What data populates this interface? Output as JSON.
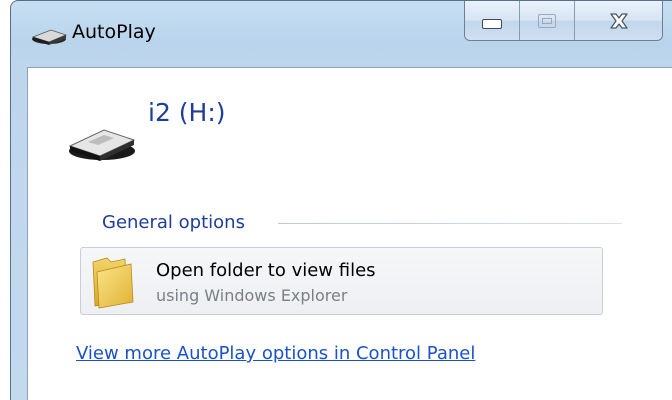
{
  "window": {
    "title": "AutoPlay",
    "title_icon": "removable-drive-icon"
  },
  "caption_buttons": {
    "minimize_icon": "minimize-icon",
    "maximize_icon": "maximize-icon",
    "close_icon": "close-icon"
  },
  "device": {
    "name": "i2 (H:)",
    "icon": "usb-drive-icon"
  },
  "general_options": {
    "header": "General options",
    "items": [
      {
        "title": "Open folder to view files",
        "subtitle": "using Windows Explorer",
        "icon": "folder-icon"
      }
    ]
  },
  "footer": {
    "link_text": "View more AutoPlay options in Control Panel"
  },
  "colors": {
    "heading_blue": "#1e3e9a",
    "link_blue": "#1a52c8",
    "subtitle_gray": "#7a7f86"
  }
}
